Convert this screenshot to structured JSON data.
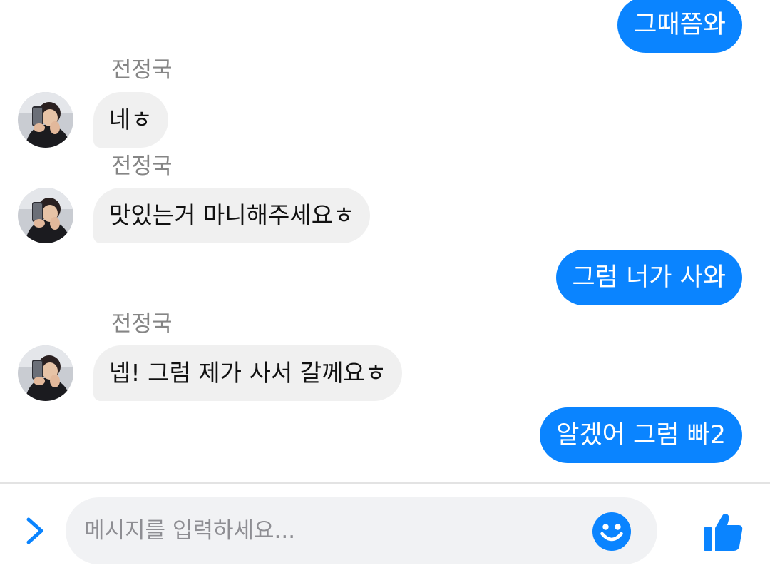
{
  "chat": {
    "sender": "전정국",
    "messages": [
      {
        "from": "me",
        "text": "그때쯤와"
      },
      {
        "from": "them",
        "sender": "전정국",
        "text": "네ㅎ"
      },
      {
        "from": "them",
        "sender": "전정국",
        "text": "맛있는거 마니해주세요ㅎ"
      },
      {
        "from": "me",
        "text": "그럼 너가 사와"
      },
      {
        "from": "them",
        "sender": "전정국",
        "text": "넵! 그럼 제가 사서 갈께요ㅎ"
      },
      {
        "from": "me",
        "text": "알겠어 그럼 빠2"
      }
    ]
  },
  "composer": {
    "placeholder": "메시지를 입력하세요...",
    "value": ""
  },
  "icons": {
    "expand": "chevron-right-icon",
    "emoji": "smiley-icon",
    "like": "thumbs-up-icon"
  },
  "colors": {
    "accent": "#0a84ff",
    "incoming_bubble": "#f0f0f0",
    "sender_name": "#858585",
    "input_background": "#f1f2f4"
  }
}
